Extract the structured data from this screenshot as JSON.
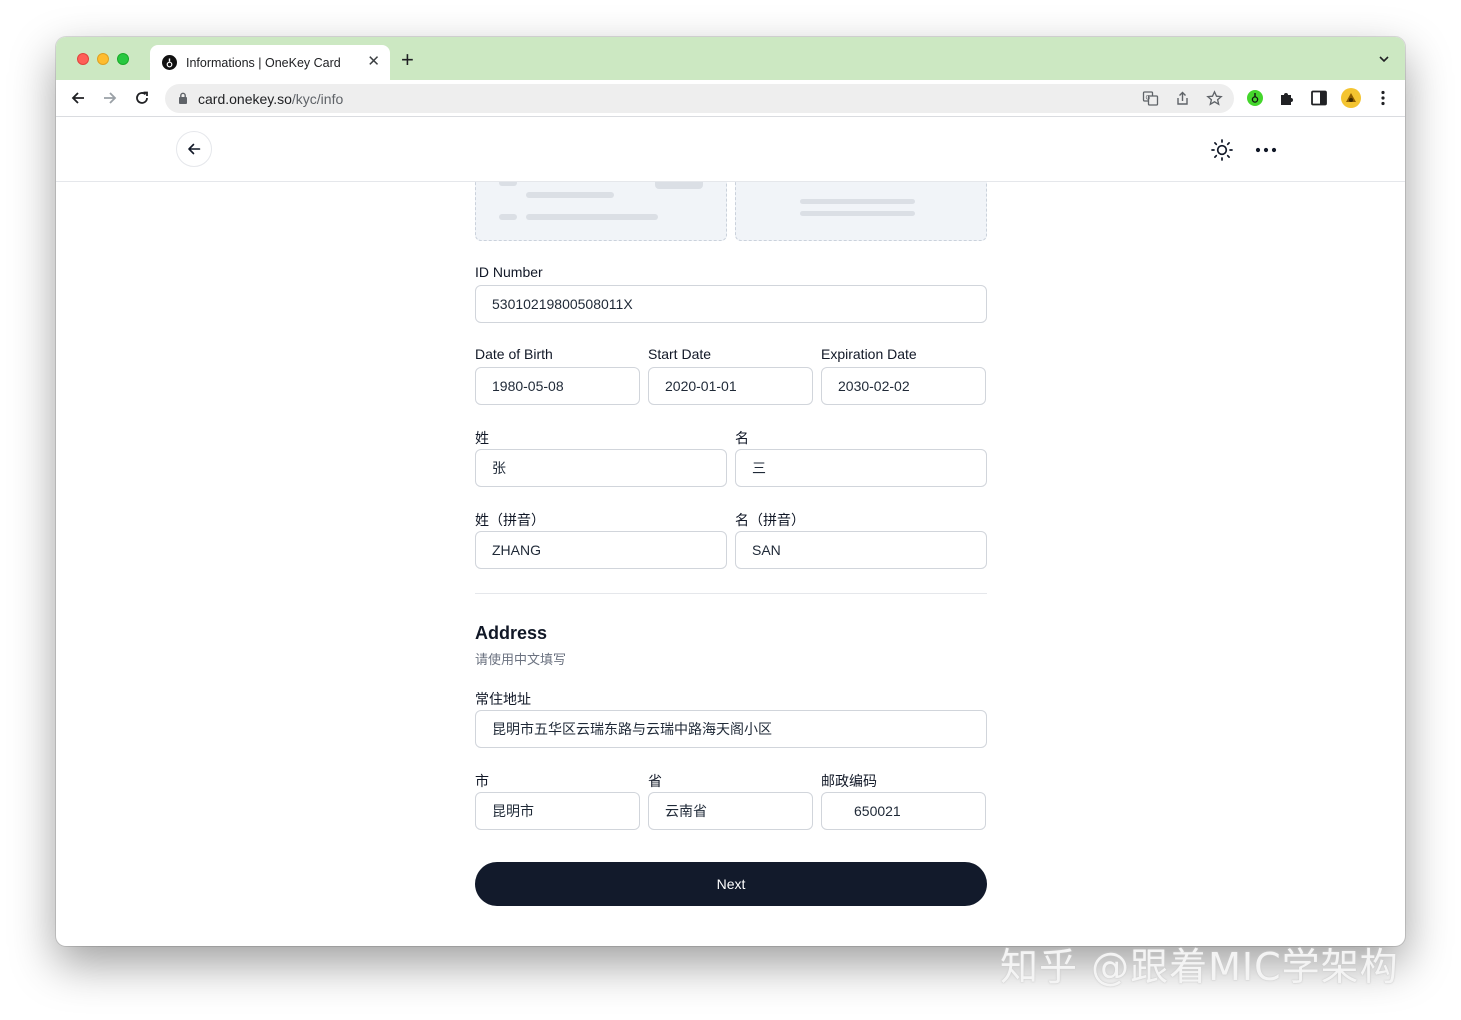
{
  "browser": {
    "tab_title": "Informations | OneKey Card",
    "tab_favicon": "onekey-logo",
    "url_host": "card.onekey.so",
    "url_path": "/kyc/info"
  },
  "form": {
    "id_number": {
      "label": "ID Number",
      "value": "53010219800508011X"
    },
    "dob": {
      "label": "Date of Birth",
      "value": "1980-05-08"
    },
    "start_date": {
      "label": "Start Date",
      "value": "2020-01-01"
    },
    "expiration_date": {
      "label": "Expiration Date",
      "value": "2030-02-02"
    },
    "surname": {
      "label": "姓",
      "value": "张"
    },
    "given_name": {
      "label": "名",
      "value": "三"
    },
    "surname_pinyin": {
      "label": "姓（拼音）",
      "value": "ZHANG"
    },
    "given_name_pinyin": {
      "label": "名（拼音）",
      "value": "SAN"
    }
  },
  "address": {
    "title": "Address",
    "subtitle": "请使用中文填写",
    "street": {
      "label": "常住地址",
      "value": "昆明市五华区云瑞东路与云瑞中路海天阁小区"
    },
    "city": {
      "label": "市",
      "value": "昆明市"
    },
    "province": {
      "label": "省",
      "value": "云南省"
    },
    "postal_code": {
      "label": "邮政编码",
      "value": "650021"
    }
  },
  "next_label": "Next",
  "watermark": "知乎 @跟着MIC学架构",
  "colors": {
    "tabstrip": "#cce8c2",
    "primary_button": "#121a2b"
  }
}
